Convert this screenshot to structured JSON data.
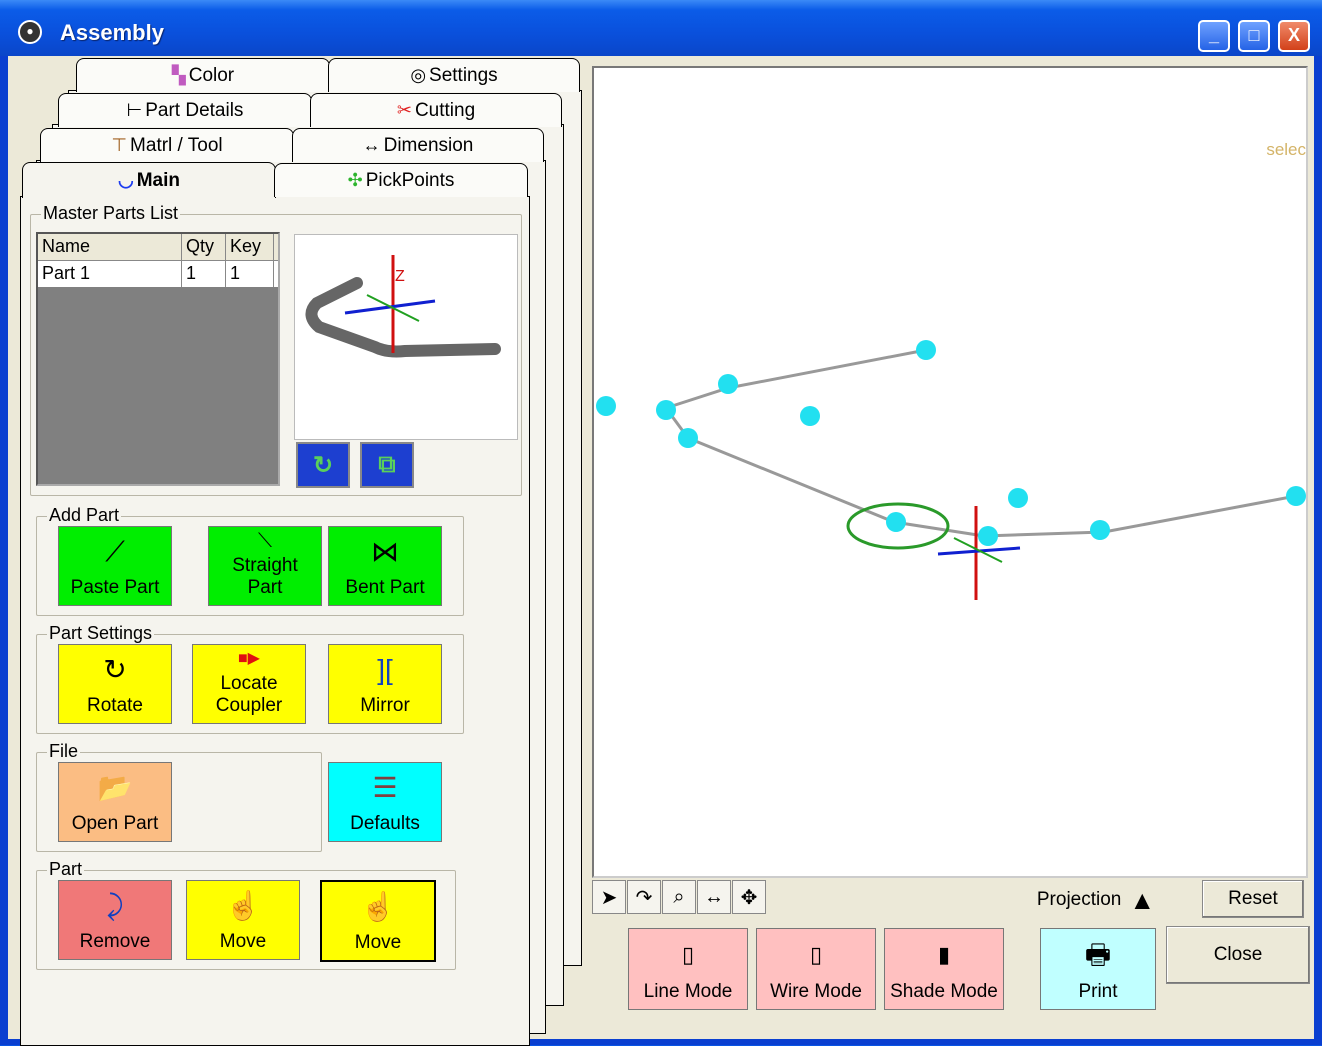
{
  "window": {
    "title": "Assembly",
    "minimize": "_",
    "maximize": "□",
    "close": "X"
  },
  "tabs": {
    "row1": [
      "Color",
      "Settings"
    ],
    "row2": [
      "Part Details",
      "Cutting"
    ],
    "row3": [
      "Matrl / Tool",
      "Dimension"
    ],
    "row4": [
      "Main",
      "PickPoints"
    ],
    "active": "Main"
  },
  "master_parts": {
    "label": "Master Parts List",
    "columns": [
      "Name",
      "Qty",
      "Key"
    ],
    "rows": [
      {
        "name": "Part 1",
        "qty": "1",
        "key": "1"
      }
    ]
  },
  "add_part": {
    "label": "Add Part",
    "paste": "Paste Part",
    "straight_1": "Straight",
    "straight_2": "Part",
    "bent": "Bent Part"
  },
  "part_settings": {
    "label": "Part Settings",
    "rotate": "Rotate",
    "locate_1": "Locate",
    "locate_2": "Coupler",
    "mirror": "Mirror"
  },
  "file": {
    "label": "File",
    "open": "Open Part",
    "defaults": "Defaults"
  },
  "part": {
    "label": "Part",
    "remove": "Remove",
    "move1": "Move",
    "move2": "Move"
  },
  "viewport": {
    "hint": "selec"
  },
  "controls": {
    "projection": "Projection",
    "reset": "Reset",
    "close": "Close",
    "line_mode": "Line Mode",
    "wire_mode": "Wire Mode",
    "shade_mode": "Shade Mode",
    "print": "Print"
  },
  "colors": {
    "green": "#00ee00",
    "yellow": "#ffff00",
    "point": "#22e0f0"
  }
}
